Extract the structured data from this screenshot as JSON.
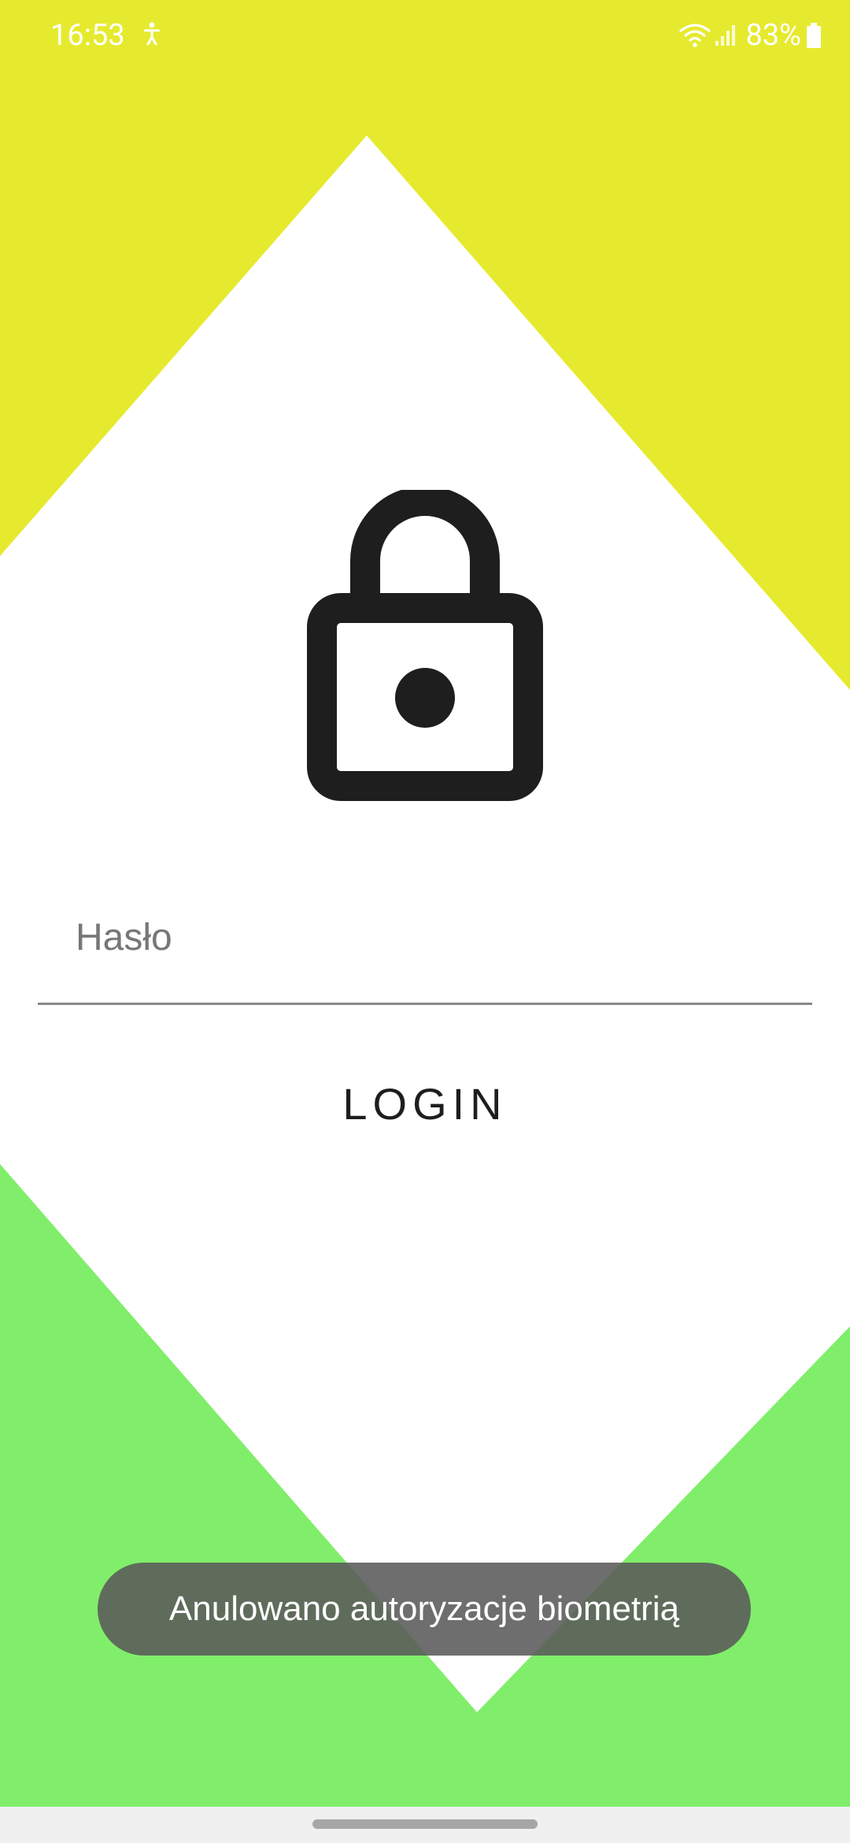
{
  "status_bar": {
    "time": "16:53",
    "battery": "83%"
  },
  "icons": {
    "lock": "lock-icon",
    "notification": "accessibility-icon",
    "wifi": "wifi-icon",
    "signal": "signal-icon",
    "battery": "battery-icon"
  },
  "colors": {
    "top_background": "#E6EA2E",
    "bottom_background": "#80EE6A",
    "foreground": "#FFFFFF",
    "icon_color": "#1E1E1E"
  },
  "login": {
    "password_placeholder": "Hasło",
    "password_value": "",
    "button_label": "LOGIN"
  },
  "toast": {
    "message": "Anulowano autoryzacje biometrią"
  }
}
